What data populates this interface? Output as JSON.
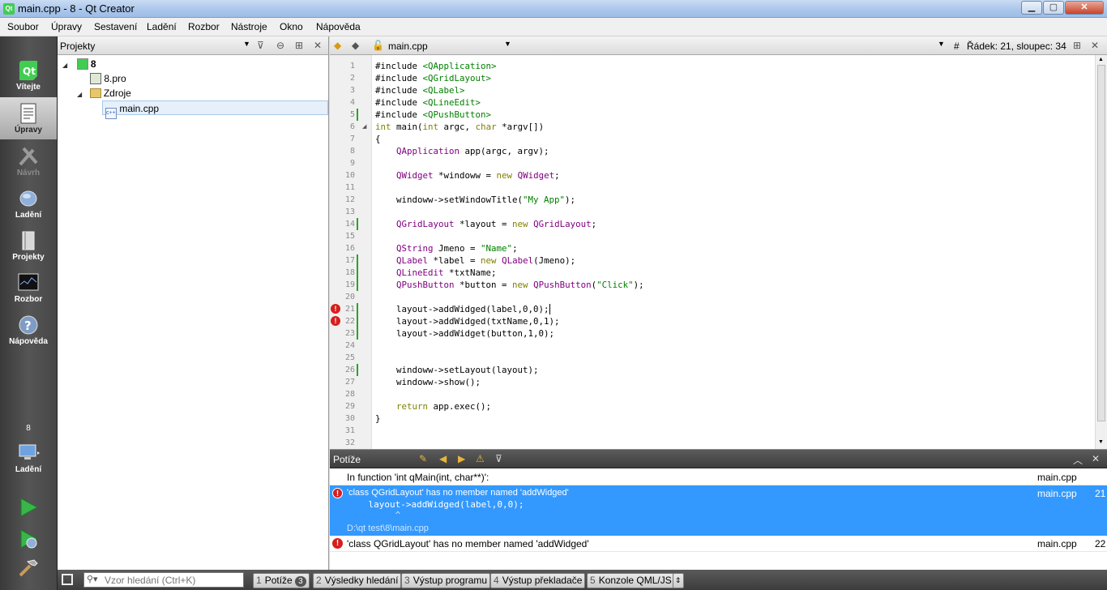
{
  "window": {
    "title": "main.cpp - 8 - Qt Creator",
    "minimize": "▁",
    "maximize": "▢",
    "close": "✕"
  },
  "menu": [
    "Soubor",
    "Úpravy",
    "Sestavení",
    "Ladění",
    "Rozbor",
    "Nástroje",
    "Okno",
    "Nápověda"
  ],
  "modes": [
    {
      "label": "Vítejte",
      "icon": "qt-logo-icon"
    },
    {
      "label": "Úpravy",
      "icon": "edit-document-icon"
    },
    {
      "label": "Návrh",
      "icon": "design-icon"
    },
    {
      "label": "Ladění",
      "icon": "debug-bug-icon"
    },
    {
      "label": "Projekty",
      "icon": "projects-icon"
    },
    {
      "label": "Rozbor",
      "icon": "analyze-icon"
    },
    {
      "label": "Nápověda",
      "icon": "help-icon"
    }
  ],
  "kit": {
    "project": "8",
    "label": "Ladění"
  },
  "projects": {
    "title": "Projekty",
    "tree": [
      {
        "name": "8",
        "level": 0,
        "icon": "qt-project-icon"
      },
      {
        "name": "8.pro",
        "level": 1,
        "icon": "pro-file-icon"
      },
      {
        "name": "Zdroje",
        "level": 1,
        "icon": "folder-icon"
      },
      {
        "name": "main.cpp",
        "level": 2,
        "icon": "cpp-file-icon"
      }
    ]
  },
  "editor": {
    "file": "main.cpp",
    "position": "Řádek: 21, sloupec: 34",
    "hash": "#",
    "lines": [
      "#include <QApplication>",
      "#include <QGridLayout>",
      "#include <QLabel>",
      "#include <QLineEdit>",
      "#include <QPushButton>",
      "int main(int argc, char *argv[])",
      "{",
      "    QApplication app(argc, argv);",
      "",
      "    QWidget *windoww = new QWidget;",
      "",
      "    windoww->setWindowTitle(\"My App\");",
      "",
      "    QGridLayout *layout = new QGridLayout;",
      "",
      "    QString Jmeno = \"Name\";",
      "    QLabel *label = new QLabel(Jmeno);",
      "    QLineEdit *txtName;",
      "    QPushButton *button = new QPushButton(\"Click\");",
      "",
      "    layout->addWidged(label,0,0);",
      "    layout->addWidged(txtName,0,1);",
      "    layout->addWidget(button,1,0);",
      "",
      "",
      "    windoww->setLayout(layout);",
      "    windoww->show();",
      "",
      "    return app.exec();",
      "}",
      "",
      ""
    ],
    "changed_lines": [
      5,
      14,
      17,
      18,
      19,
      21,
      22,
      23,
      26
    ],
    "error_lines": [
      21,
      22
    ]
  },
  "issues": {
    "title": "Potíže",
    "items": [
      {
        "text": "In function 'int qMain(int, char**)':",
        "file": "main.cpp",
        "line": "",
        "type": "info"
      },
      {
        "text": "'class QGridLayout' has no member named 'addWidged'",
        "code": "    layout->addWidged(label,0,0);",
        "caret": "         ^",
        "path": "D:\\qt test\\8\\main.cpp",
        "file": "main.cpp",
        "line": "21",
        "type": "error",
        "selected": true
      },
      {
        "text": "'class QGridLayout' has no member named 'addWidged'",
        "file": "main.cpp",
        "line": "22",
        "type": "error"
      }
    ]
  },
  "status": {
    "search_placeholder": "Vzor hledání (Ctrl+K)",
    "tabs": [
      {
        "num": "1",
        "label": "Potíže",
        "badge": "3"
      },
      {
        "num": "2",
        "label": "Výsledky hledání"
      },
      {
        "num": "3",
        "label": "Výstup programu"
      },
      {
        "num": "4",
        "label": "Výstup překladače"
      },
      {
        "num": "5",
        "label": "Konzole QML/JS"
      }
    ]
  }
}
